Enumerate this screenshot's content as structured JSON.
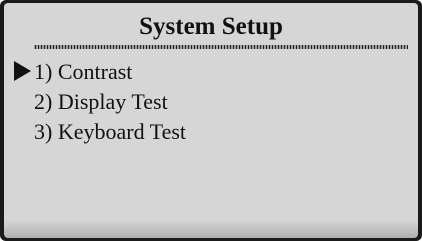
{
  "screen": {
    "title": "System Setup",
    "menu": {
      "selected_index": 0,
      "items": [
        {
          "label": "1) Contrast"
        },
        {
          "label": "2) Display Test"
        },
        {
          "label": "3) Keyboard Test"
        }
      ]
    },
    "cursor_icon": "right-triangle-pointer-icon",
    "colors": {
      "background": "#d6d6d6",
      "text": "#111111",
      "bezel": "#1a1a1a"
    }
  }
}
